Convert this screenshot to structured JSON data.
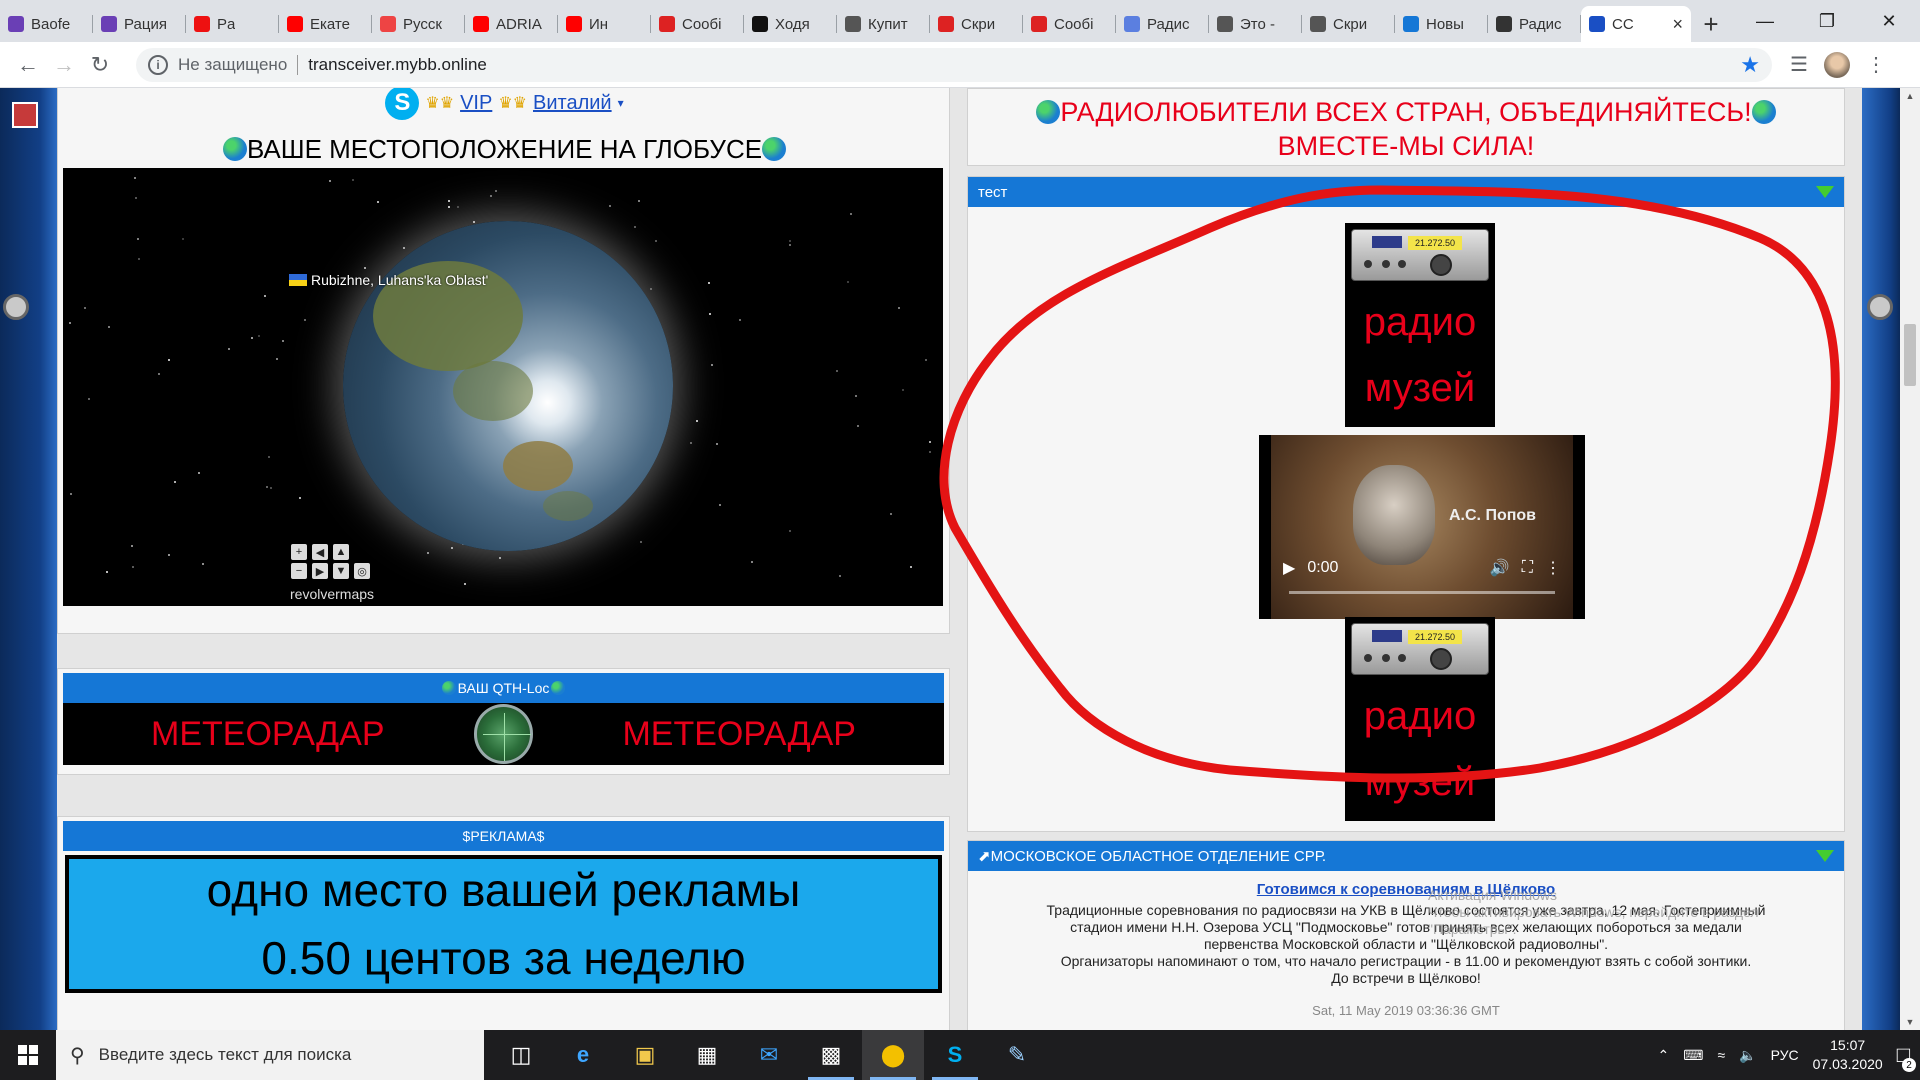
{
  "browser": {
    "tabs": [
      {
        "label": "Baofe",
        "color": "#6a3fb5"
      },
      {
        "label": "Рация",
        "color": "#6a3fb5"
      },
      {
        "label": "Pa",
        "color": "#e11"
      },
      {
        "label": "Екате",
        "color": "#f00"
      },
      {
        "label": "Русск",
        "color": "#e44"
      },
      {
        "label": "ADRIA",
        "color": "#f00"
      },
      {
        "label": "Ин",
        "color": "#f00"
      },
      {
        "label": "Сообі",
        "color": "#d22"
      },
      {
        "label": "Ходя",
        "color": "#111"
      },
      {
        "label": "Купит",
        "color": "#555"
      },
      {
        "label": "Скри",
        "color": "#d22"
      },
      {
        "label": "Сообі",
        "color": "#d22"
      },
      {
        "label": "Радис",
        "color": "#5b7fe0"
      },
      {
        "label": "Это -",
        "color": "#555"
      },
      {
        "label": "Скри",
        "color": "#555"
      },
      {
        "label": "Новы",
        "color": "#1577d6"
      },
      {
        "label": "Радис",
        "color": "#333"
      },
      {
        "label": "CC",
        "color": "#1a4fc4",
        "active": true
      }
    ],
    "new_tab": "+",
    "address": {
      "security": "Не защищено",
      "url": "transceiver.mybb.online"
    }
  },
  "page": {
    "user": {
      "prefix": "VIP",
      "name": "Виталий",
      "caret": "▾"
    },
    "globe_title": "ВАШЕ МЕСТОПОЛОЖЕНИЕ НА ГЛОБУСЕ",
    "globe": {
      "location": "Rubizhne, Luhans'ka Oblast'",
      "brand": "revolvermaps"
    },
    "qth": {
      "title": "ВАШ QTH-Loc",
      "left": "МЕТЕОРАДАР",
      "right": "МЕТЕОРАДАР"
    },
    "ad": {
      "title": "$РЕКЛАМА$",
      "line1": "одно место вашей рекламы",
      "line2": "0.50 центов за неделю"
    },
    "slogan": {
      "line1": "РАДИОЛЮБИТЕЛИ ВСЕХ СТРАН, ОБЪЕДИНЯЙТЕСЬ!",
      "line2": "ВМЕСТЕ-МЫ СИЛА!"
    },
    "test_panel": {
      "title": "тест",
      "card_text_line1": "радио",
      "card_text_line2": "музей",
      "display": "21.272.50",
      "video": {
        "caption": "А.С. Попов",
        "time": "0:00"
      }
    },
    "mos_panel": {
      "title": "МОСКОВСКОЕ ОБЛАСТНОЕ ОТДЕЛЕНИЕ СРР.",
      "news_title": "Готовимся к соревнованиям в Щёлково",
      "body_lines": [
        "Традиционные соревнования по радиосвязи на УКВ в Щёлково состоятся уже завтра, 12 мая. Гостеприимный",
        "стадион имени Н.Н. Озерова УСЦ \"Подмосковье\" готов принять всех желающих побороться за медали",
        "первенства Московской области и \"Щёлковской радиоволны\".",
        "Организаторы напоминают о том, что начало регистрации - в 11.00 и рекомендуют взять с собой зонтики.",
        "До встречи в Щёлково!"
      ],
      "date": "Sat, 11 May 2019 03:36:36 GMT",
      "activation_line1": "Активация Windows",
      "activation_line2": "Чтобы активировать Windows, перейдите в раздел",
      "activation_line3": "\"Параметры\"."
    }
  },
  "taskbar": {
    "search_placeholder": "Введите здесь текст для поиска",
    "lang": "РУС",
    "time": "15:07",
    "date": "07.03.2020",
    "notifications": "2"
  },
  "colors": {
    "accent_blue": "#1577d6",
    "slogan_red": "#e8001a",
    "annotation_red": "#e41414"
  }
}
